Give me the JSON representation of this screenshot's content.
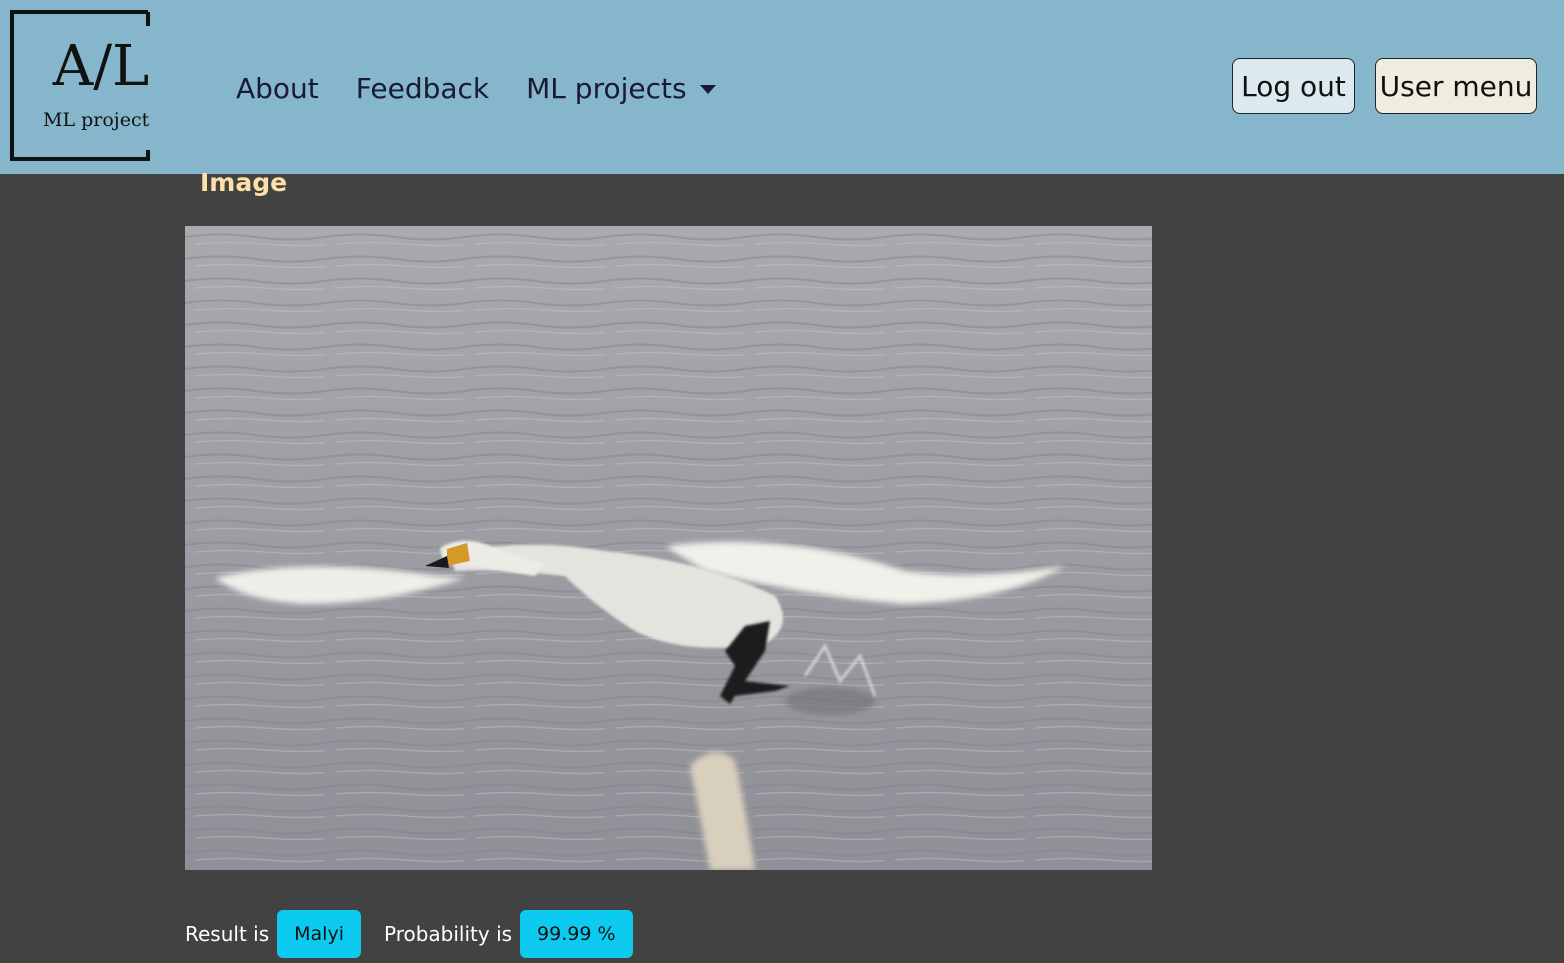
{
  "navbar": {
    "logo_main": "A/L",
    "logo_sub": "ML projects",
    "links": [
      "About",
      "Feedback"
    ],
    "dropdown_label": "ML projects",
    "logout_label": "Log out",
    "user_menu_label": "User menu"
  },
  "main": {
    "heading": "Image",
    "result_label": "Result is",
    "result_value": "Malyi",
    "probability_label": "Probability is",
    "probability_value": "99.99 %"
  },
  "colors": {
    "navbar_bg": "#86b6cb",
    "page_bg": "#424242",
    "heading": "#ffdfa8",
    "badge": "#0dcaf0"
  },
  "icons": [
    "logo-frame-icon",
    "chevron-down-icon"
  ]
}
